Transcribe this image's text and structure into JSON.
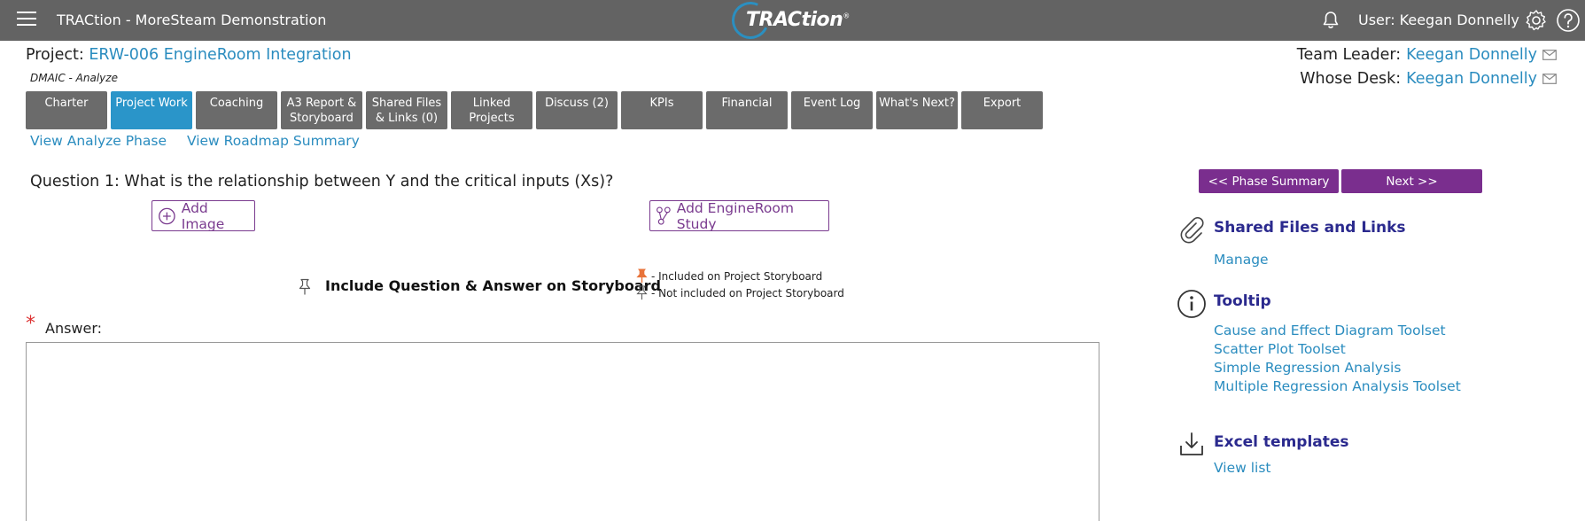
{
  "topbar": {
    "app_title": "TRACtion - MoreSteam Demonstration",
    "logo_text": "TRACtion",
    "logo_mark": "®",
    "user_label": "User: Keegan Donnelly",
    "icons": [
      "menu-icon",
      "bell-icon",
      "gear-icon",
      "help-icon"
    ]
  },
  "project": {
    "label": "Project:",
    "name": "ERW-006 EngineRoom Integration",
    "phase": "DMAIC - Analyze"
  },
  "team": {
    "leader_label": "Team Leader:",
    "leader_name": "Keegan Donnelly",
    "desk_label": "Whose Desk:",
    "desk_name": "Keegan Donnelly"
  },
  "tabs": [
    {
      "line1": "Charter",
      "line2": ""
    },
    {
      "line1": "Project Work",
      "line2": ""
    },
    {
      "line1": "Coaching",
      "line2": ""
    },
    {
      "line1": "A3 Report &",
      "line2": "Storyboard"
    },
    {
      "line1": "Shared Files",
      "line2": "& Links (0)"
    },
    {
      "line1": "Linked",
      "line2": "Projects"
    },
    {
      "line1": "Discuss (2)",
      "line2": ""
    },
    {
      "line1": "KPIs",
      "line2": ""
    },
    {
      "line1": "Financial",
      "line2": ""
    },
    {
      "line1": "Event Log",
      "line2": ""
    },
    {
      "line1": "What's Next?",
      "line2": ""
    },
    {
      "line1": "Export",
      "line2": ""
    }
  ],
  "active_tab": "Project Work",
  "sublinks": {
    "analyze": "View Analyze Phase",
    "roadmap": "View Roadmap Summary"
  },
  "question": {
    "text": "Question 1: What is the relationship between Y and the critical inputs (Xs)?",
    "add_image": "Add Image",
    "add_study": "Add EngineRoom Study",
    "include_label": "Include Question & Answer on Storyboard",
    "legend_included": "- Included on Project Storyboard",
    "legend_not_included": "- Not included on Project Storyboard",
    "required_mark": "*",
    "answer_label": "Answer:",
    "answer_value": ""
  },
  "nav": {
    "phase_summary": "<< Phase Summary",
    "next": "Next >>"
  },
  "sidebar": {
    "shared": {
      "title": "Shared Files and Links",
      "links": [
        "Manage"
      ]
    },
    "tooltip": {
      "title": "Tooltip",
      "links": [
        "Cause and Effect Diagram Toolset",
        "Scatter Plot Toolset",
        "Simple Regression Analysis",
        "Multiple Regression Analysis Toolset"
      ]
    },
    "excel": {
      "title": "Excel templates",
      "links": [
        "View list"
      ]
    }
  },
  "colors": {
    "topbar": "#636363",
    "tab": "#6b6b6b",
    "tab_active": "#2a95c9",
    "link": "#2a8cbf",
    "purple": "#7a2e8e",
    "heading": "#2b2a8e",
    "pin_active": "#e8733a"
  }
}
